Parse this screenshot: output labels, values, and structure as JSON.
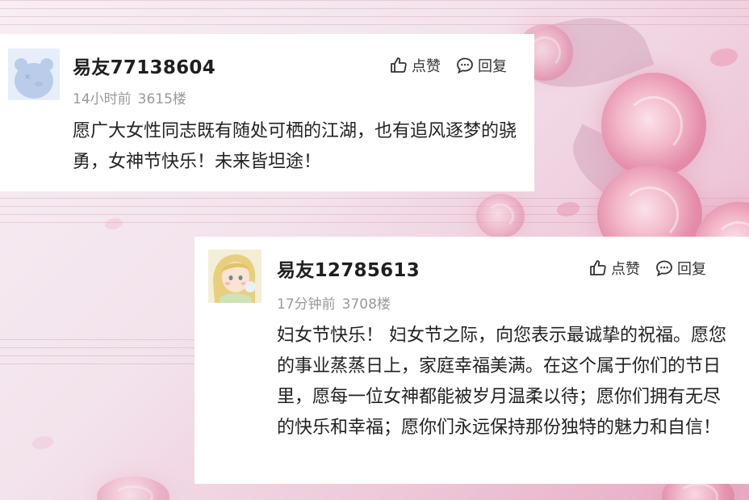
{
  "comments": [
    {
      "username": "易友77138604",
      "time": "14小时前",
      "floor": "3615楼",
      "like_label": "点赞",
      "reply_label": "回复",
      "content": "愿广大女性同志既有随处可栖的江湖，也有追风逐梦的骁勇，女神节快乐！未来皆坦途！",
      "avatar_icon": "bear-avatar-icon"
    },
    {
      "username": "易友12785613",
      "time": "17分钟前",
      "floor": "3708楼",
      "like_label": "点赞",
      "reply_label": "回复",
      "content": "妇女节快乐！ 妇女节之际，向您表示最诚挚的祝福。愿您的事业蒸蒸日上，家庭幸福美满。在这个属于你们的节日里，愿每一位女神都能被岁月温柔以待；愿你们拥有无尽的快乐和幸福；愿你们永远保持那份独特的魅力和自信！",
      "avatar_icon": "girl-avatar-icon"
    }
  ],
  "colors": {
    "background_accent": "#e8a9c2",
    "card": "#ffffff",
    "meta_text": "#9a9a9a"
  }
}
